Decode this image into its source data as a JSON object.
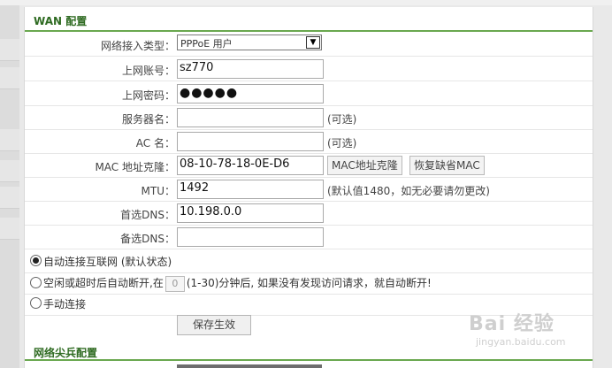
{
  "wan": {
    "title": "WAN 配置",
    "connection_type": {
      "label": "网络接入类型：",
      "value": "PPPoE 用户"
    },
    "account": {
      "label": "上网账号：",
      "value": "sz770"
    },
    "password": {
      "label": "上网密码：",
      "value": "●●●●●"
    },
    "service_name": {
      "label": "服务器名：",
      "value": "",
      "hint": "(可选)"
    },
    "ac_name": {
      "label": "AC 名：",
      "value": "",
      "hint": "(可选)"
    },
    "mac_clone": {
      "label": "MAC 地址克隆：",
      "value": "08-10-78-18-0E-D6",
      "clone_button": "MAC地址克隆",
      "restore_button": "恢复缺省MAC"
    },
    "mtu": {
      "label": "MTU：",
      "value": "1492",
      "hint": "(默认值1480，如无必要请勿更改)"
    },
    "primary_dns": {
      "label": "首选DNS：",
      "value": "10.198.0.0"
    },
    "secondary_dns": {
      "label": "备选DNS：",
      "value": ""
    },
    "modes": {
      "auto": "自动连接互联网 (默认状态)",
      "idle_prefix": "空闲或超时后自动断开,在",
      "idle_value": "0",
      "idle_suffix": "(1-30)分钟后, 如果没有发现访问请求，就自动断开!",
      "manual": "手动连接"
    },
    "save_button": "保存生效"
  },
  "next_section": {
    "title": "网络尖兵配置"
  },
  "watermark": {
    "brand": "Bai 经验",
    "url": "jingyan.baidu.com"
  }
}
